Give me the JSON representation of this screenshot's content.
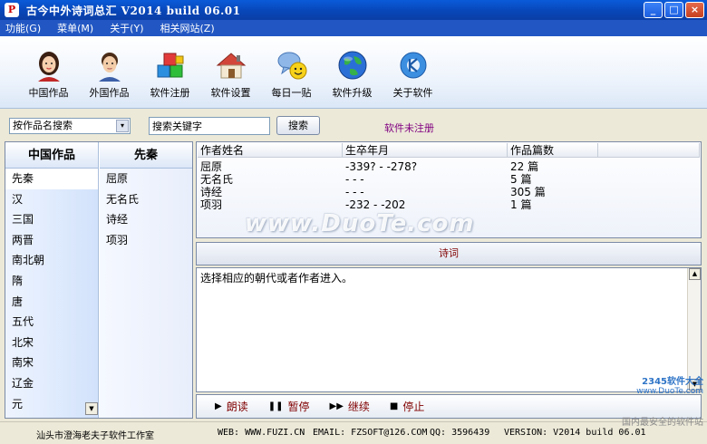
{
  "window": {
    "title": "古今中外诗词总汇 V2014 build 06.01",
    "app_icon": "P",
    "minimize": "_",
    "maximize": "□",
    "close": "×"
  },
  "menu": [
    {
      "label": "功能(G)"
    },
    {
      "label": "菜单(M)"
    },
    {
      "label": "关于(Y)"
    },
    {
      "label": "相关网站(Z)"
    }
  ],
  "toolbar": [
    {
      "label": "中国作品",
      "icon": "chinese-woman-icon"
    },
    {
      "label": "外国作品",
      "icon": "foreign-man-icon"
    },
    {
      "label": "软件注册",
      "icon": "blocks-icon"
    },
    {
      "label": "软件设置",
      "icon": "house-icon"
    },
    {
      "label": "每日一贴",
      "icon": "chat-smiley-icon"
    },
    {
      "label": "软件升级",
      "icon": "globe-icon"
    },
    {
      "label": "关于软件",
      "icon": "kde-gear-icon"
    }
  ],
  "search": {
    "type_selected": "按作品名搜索",
    "keyword": "搜索关键字",
    "button": "搜索",
    "reg_status": "软件未注册"
  },
  "left": {
    "dynasty_header": "中国作品",
    "dynasties": [
      "先秦",
      "汉",
      "三国",
      "两晋",
      "南北朝",
      "隋",
      "唐",
      "五代",
      "北宋",
      "南宋",
      "辽金",
      "元"
    ],
    "author_header": "先秦",
    "authors": [
      "屈原",
      "无名氏",
      "诗经",
      "项羽"
    ]
  },
  "table": {
    "headers": [
      "作者姓名",
      "生卒年月",
      "作品篇数",
      ""
    ],
    "rows": [
      [
        "屈原",
        "-339? - -278?",
        "22 篇",
        ""
      ],
      [
        "无名氏",
        "- - -",
        "5 篇",
        ""
      ],
      [
        "诗经",
        "- - -",
        "305 篇",
        ""
      ],
      [
        "项羽",
        "-232 - -202",
        "1 篇",
        ""
      ]
    ]
  },
  "watermark": "www.DuoTe.com",
  "poem": {
    "header": "诗词",
    "text": "选择相应的朝代或者作者进入。"
  },
  "playback": [
    {
      "glyph": "▶",
      "label": "朗读"
    },
    {
      "glyph": "❚❚",
      "label": "暂停"
    },
    {
      "glyph": "▶▶",
      "label": "继续"
    },
    {
      "glyph": "■",
      "label": "停止"
    }
  ],
  "status": {
    "studio": "汕头市澄海老夫子软件工作室",
    "web": "WEB: WWW.FUZI.CN",
    "email": "EMAIL: FZSOFT@126.COM",
    "qq": "QQ: 3596439",
    "version": "VERSION: V2014 build 06.01"
  },
  "corner_mark": {
    "line1": "2345软件大全",
    "line2": "www.DuoTe.com",
    "line3": "国内最安全的软件站"
  }
}
